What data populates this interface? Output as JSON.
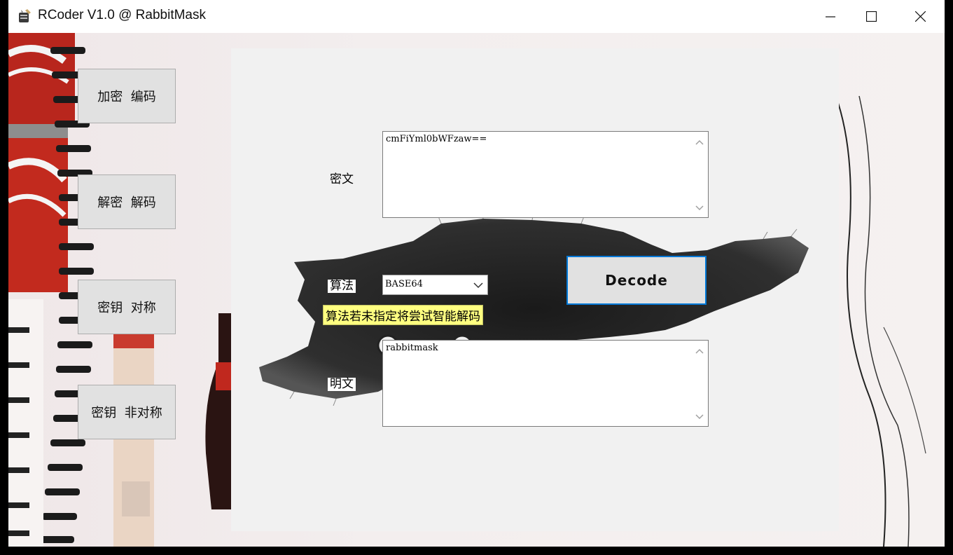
{
  "window": {
    "title": "RCoder V1.0 @ RabbitMask"
  },
  "sidebar": {
    "items": [
      {
        "label": "加密  编码"
      },
      {
        "label": "解密  解码"
      },
      {
        "label": "密钥  对称"
      },
      {
        "label": "密钥  非对称"
      }
    ]
  },
  "decode_panel": {
    "ciphertext_label": "密文",
    "ciphertext_value": "cmFiYml0bWFzaw==",
    "algorithm_label": "算法",
    "algorithm_selected": "BASE64",
    "hint_text": "算法若未指定将尝试智能解码",
    "plaintext_label": "明文",
    "plaintext_value": "rabbitmask",
    "decode_button": "Decode"
  }
}
